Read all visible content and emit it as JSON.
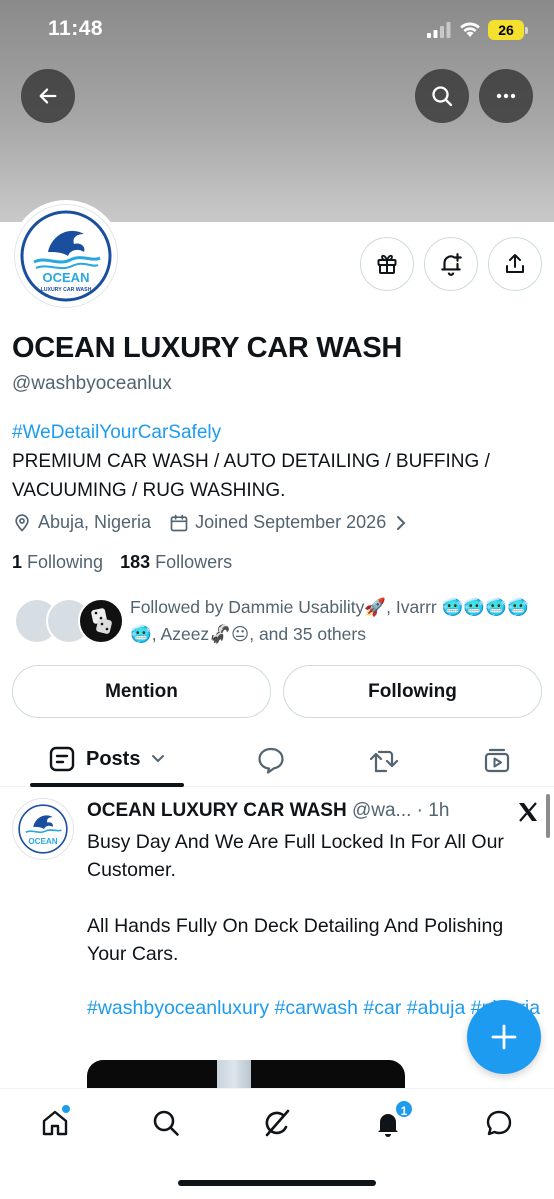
{
  "status_bar": {
    "time": "11:48",
    "battery": "26"
  },
  "profile": {
    "name": "OCEAN LUXURY CAR WASH",
    "handle": "@washbyoceanlux",
    "bio_hashtag": "#WeDetailYourCarSafely",
    "bio_text": "PREMIUM CAR WASH / AUTO DETAILING / BUFFING / VACUUMING / RUG WASHING.",
    "location": "Abuja, Nigeria",
    "joined": "Joined September 2026",
    "following_count": "1",
    "following_label": "Following",
    "followers_count": "183",
    "followers_label": "Followers",
    "followed_by": "Followed by Dammie Usability🚀, Ivarrr 🥶🥶🥶🥶🥶, Azeez🦨😐, and 35 others",
    "logo_text": "OCEAN",
    "logo_subtext": "LUXURY CAR WASH"
  },
  "actions": {
    "mention": "Mention",
    "following": "Following"
  },
  "tabs": {
    "posts": "Posts"
  },
  "post": {
    "author": "OCEAN LUXURY CAR WASH",
    "handle_time": "@wa... · 1h",
    "text": "Busy Day And We Are Full Locked In For All Our Customer.\n\nAll Hands Fully On Deck Detailing And Polishing Your Cars.",
    "tags": "#washbyoceanluxury #carwash #car #abuja #nigeria"
  },
  "nav": {
    "notifications_badge": "1"
  },
  "colors": {
    "accent": "#1d9bf0",
    "text": "#0f1419",
    "muted": "#536471",
    "logo_blue": "#1a4fa0",
    "logo_cyan": "#29a8e0"
  },
  "icons": [
    "back-arrow-icon",
    "search-icon",
    "more-icon",
    "gift-icon",
    "bell-add-icon",
    "share-icon",
    "location-icon",
    "calendar-icon",
    "chevron-right-icon",
    "posts-icon",
    "replies-icon",
    "reposts-icon",
    "media-icon",
    "x-logo-icon",
    "plus-icon",
    "home-icon",
    "grok-icon",
    "notifications-icon",
    "messages-icon"
  ]
}
